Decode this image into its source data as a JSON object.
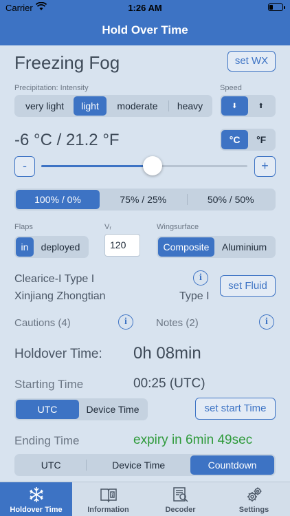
{
  "status": {
    "carrier": "Carrier",
    "time": "1:26 AM"
  },
  "nav": {
    "title": "Hold Over Time"
  },
  "weather": {
    "condition": "Freezing Fog",
    "set_wx": "set WX"
  },
  "precip": {
    "label": "Precipitation: Intensity",
    "options": [
      "very light",
      "light",
      "moderate",
      "heavy"
    ],
    "selected": 1
  },
  "speed": {
    "label": "Speed",
    "options": [
      "⬇",
      "⬆"
    ],
    "selected": 0
  },
  "temperature": {
    "value": "-6 °C / 21.2 °F",
    "units": [
      "°C",
      "°F"
    ],
    "selected_unit": 0,
    "minus": "-",
    "plus": "+",
    "slider_fraction": 0.54
  },
  "mix": {
    "options": [
      "100% / 0%",
      "75% / 25%",
      "50% / 50%"
    ],
    "selected": 0
  },
  "flaps": {
    "label": "Flaps",
    "options": [
      "in",
      "deployed"
    ],
    "selected": 0
  },
  "vr": {
    "label": "Vᵣ",
    "value": "120"
  },
  "wingsurface": {
    "label": "Wingsurface",
    "options": [
      "Composite",
      "Aluminium"
    ],
    "selected": 0
  },
  "fluid": {
    "name": "Clearice-I Type I",
    "manufacturer": "Xinjiang Zhongtian",
    "type": "Type I",
    "set_fluid": "set Fluid"
  },
  "cautions": {
    "label": "Cautions (4)"
  },
  "notes": {
    "label": "Notes (2)"
  },
  "holdover": {
    "label": "Holdover Time:",
    "value": "0h 08min"
  },
  "starting": {
    "label": "Starting Time",
    "value": "00:25 (UTC)",
    "options": [
      "UTC",
      "Device Time"
    ],
    "selected": 0,
    "set_start": "set start Time"
  },
  "ending": {
    "label": "Ending Time",
    "value": "expiry in 6min 49sec",
    "options": [
      "UTC",
      "Device Time",
      "Countdown"
    ],
    "selected": 2,
    "value_color": "#2e9a3a"
  },
  "tabs": [
    {
      "label": "Holdover Time",
      "icon": "snowflake-icon",
      "active": true
    },
    {
      "label": "Information",
      "icon": "book-icon",
      "active": false
    },
    {
      "label": "Decoder",
      "icon": "document-search-icon",
      "active": false
    },
    {
      "label": "Settings",
      "icon": "gears-icon",
      "active": false
    }
  ],
  "colors": {
    "accent": "#3d73c4",
    "background": "#d8e3ef",
    "segment": "#c5d2e0",
    "expiry": "#2e9a3a"
  }
}
